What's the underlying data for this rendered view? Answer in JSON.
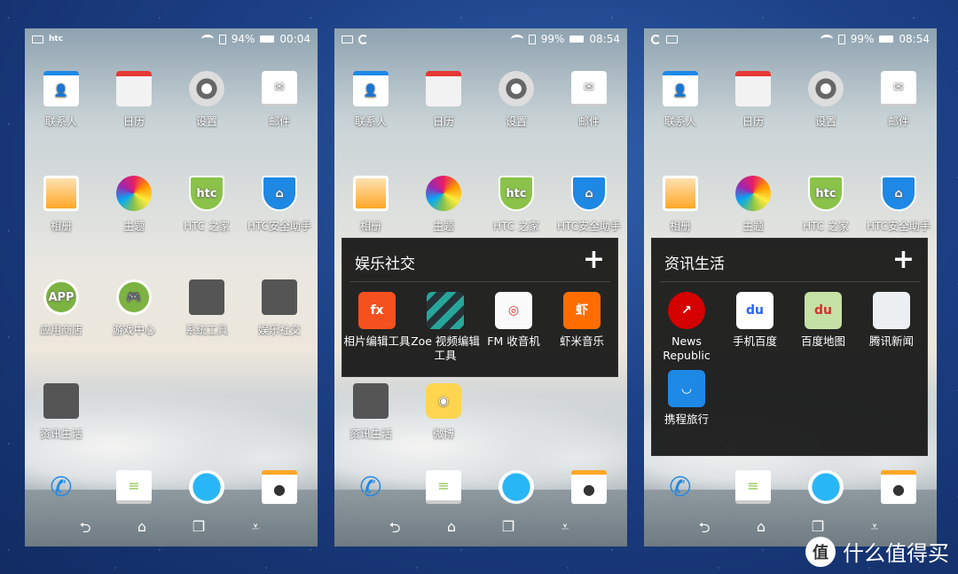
{
  "screens": [
    {
      "status": {
        "left_icons": [
          "screenshot-icon",
          "htc-logo"
        ],
        "htc_label": "htc",
        "battery": "94%",
        "time": "00:04"
      },
      "home": [
        {
          "label": "联系人",
          "icon": "contacts"
        },
        {
          "label": "日历",
          "icon": "calendar"
        },
        {
          "label": "设置",
          "icon": "settings"
        },
        {
          "label": "邮件",
          "icon": "mail"
        },
        {
          "label": "相册",
          "icon": "gallery"
        },
        {
          "label": "主题",
          "icon": "themes"
        },
        {
          "label": "HTC 之家",
          "icon": "htc"
        },
        {
          "label": "HTC安全助手",
          "icon": "shield"
        },
        {
          "label": "应用商店",
          "icon": "appstore"
        },
        {
          "label": "游戏中心",
          "icon": "gamecenter"
        },
        {
          "label": "系统工具",
          "icon": "folder"
        },
        {
          "label": "娱乐社交",
          "icon": "folder2"
        },
        {
          "label": "资讯生活",
          "icon": "folder3"
        }
      ],
      "folder": null
    },
    {
      "status": {
        "left_icons": [
          "screenshot-icon",
          "sync-icon"
        ],
        "battery": "99%",
        "time": "08:54"
      },
      "home": [
        {
          "label": "联系人",
          "icon": "contacts"
        },
        {
          "label": "日历",
          "icon": "calendar"
        },
        {
          "label": "设置",
          "icon": "settings"
        },
        {
          "label": "邮件",
          "icon": "mail"
        },
        {
          "label": "相册",
          "icon": "gallery"
        },
        {
          "label": "主题",
          "icon": "themes"
        },
        {
          "label": "HTC 之家",
          "icon": "htc"
        },
        {
          "label": "HTC安全助手",
          "icon": "shield"
        },
        {
          "label": "资讯生活",
          "icon": "folder3"
        },
        {
          "label": "微博",
          "icon": "weibo"
        }
      ],
      "folder": {
        "title": "娱乐社交",
        "add_label": "+",
        "apps": [
          {
            "label": "相片编辑工具",
            "icon": "fx"
          },
          {
            "label": "Zoe 视频编辑工具",
            "icon": "zoe"
          },
          {
            "label": "FM 收音机",
            "icon": "fm"
          },
          {
            "label": "虾米音乐",
            "icon": "xiami"
          }
        ]
      }
    },
    {
      "status": {
        "left_icons": [
          "sync-icon",
          "screenshot-icon"
        ],
        "battery": "99%",
        "time": "08:54"
      },
      "home": [
        {
          "label": "联系人",
          "icon": "contacts"
        },
        {
          "label": "日历",
          "icon": "calendar"
        },
        {
          "label": "设置",
          "icon": "settings"
        },
        {
          "label": "邮件",
          "icon": "mail"
        },
        {
          "label": "相册",
          "icon": "gallery"
        },
        {
          "label": "主题",
          "icon": "themes"
        },
        {
          "label": "HTC 之家",
          "icon": "htc"
        },
        {
          "label": "HTC安全助手",
          "icon": "shield"
        }
      ],
      "folder": {
        "title": "资讯生活",
        "add_label": "+",
        "apps": [
          {
            "label": "News Republic",
            "icon": "newsrepublic"
          },
          {
            "label": "手机百度",
            "icon": "baidu"
          },
          {
            "label": "百度地图",
            "icon": "baidumap"
          },
          {
            "label": "腾讯新闻",
            "icon": "qqnews"
          },
          {
            "label": "携程旅行",
            "icon": "ctrip"
          }
        ]
      }
    }
  ],
  "dock": [
    "phone-icon",
    "messages-icon",
    "browser-icon",
    "camera-icon"
  ],
  "nav": {
    "back": "⮌",
    "home": "⌂",
    "recents": "❐",
    "menu": "⩡"
  },
  "watermark": {
    "badge": "值",
    "text": "什么值得买"
  }
}
